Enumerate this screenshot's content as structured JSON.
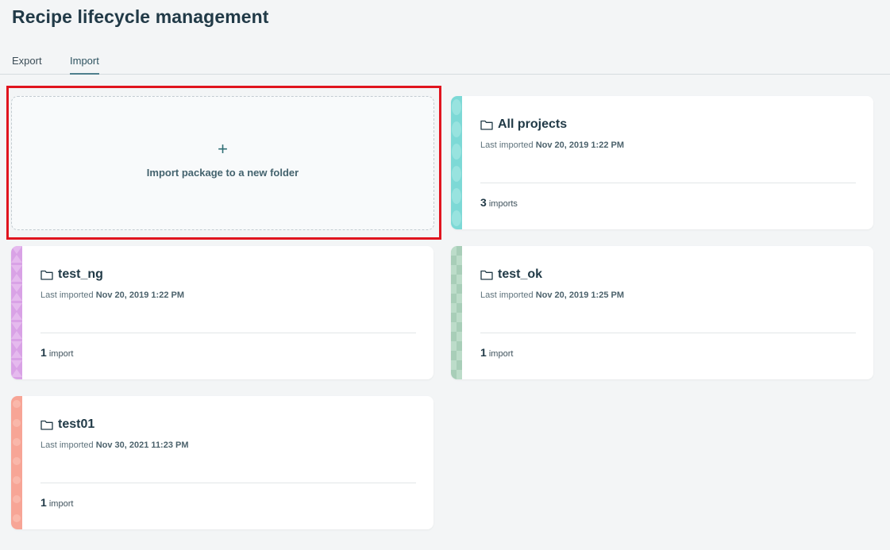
{
  "page": {
    "title": "Recipe lifecycle management"
  },
  "tabs": [
    {
      "label": "Export",
      "active": false
    },
    {
      "label": "Import",
      "active": true
    }
  ],
  "new_folder_card": {
    "icon": "plus-icon",
    "plus": "+",
    "label": "Import package to a new folder"
  },
  "colors": {
    "accent": "#4e7f8d",
    "highlight": "#e0141e",
    "stripe_all_projects": "#7dd9d6",
    "stripe_test_ng": "#d9a2e6",
    "stripe_test_ok": "#a8ceb8",
    "stripe_test01": "#f7a596"
  },
  "folders": [
    {
      "name": "All projects",
      "last_imported_label": "Last imported",
      "last_imported": "Nov 20, 2019 1:22 PM",
      "count": "3",
      "count_label": "imports"
    },
    {
      "name": "test_ng",
      "last_imported_label": "Last imported",
      "last_imported": "Nov 20, 2019 1:22 PM",
      "count": "1",
      "count_label": "import"
    },
    {
      "name": "test_ok",
      "last_imported_label": "Last imported",
      "last_imported": "Nov 20, 2019 1:25 PM",
      "count": "1",
      "count_label": "import"
    },
    {
      "name": "test01",
      "last_imported_label": "Last imported",
      "last_imported": "Nov 30, 2021 11:23 PM",
      "count": "1",
      "count_label": "import"
    }
  ]
}
